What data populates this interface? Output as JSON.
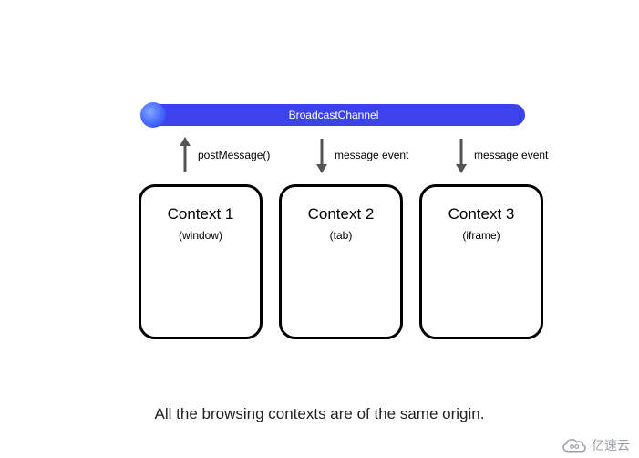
{
  "channel": {
    "label": "BroadcastChannel"
  },
  "arrows": {
    "up_label": "postMessage()",
    "down1_label": "message event",
    "down2_label": "message event"
  },
  "contexts": [
    {
      "title": "Context 1",
      "subtitle": "(window)"
    },
    {
      "title": "Context 2",
      "subtitle": "(tab)"
    },
    {
      "title": "Context 3",
      "subtitle": "(iframe)"
    }
  ],
  "caption": "All the browsing contexts are of the same origin.",
  "watermark": {
    "text": "亿速云"
  }
}
